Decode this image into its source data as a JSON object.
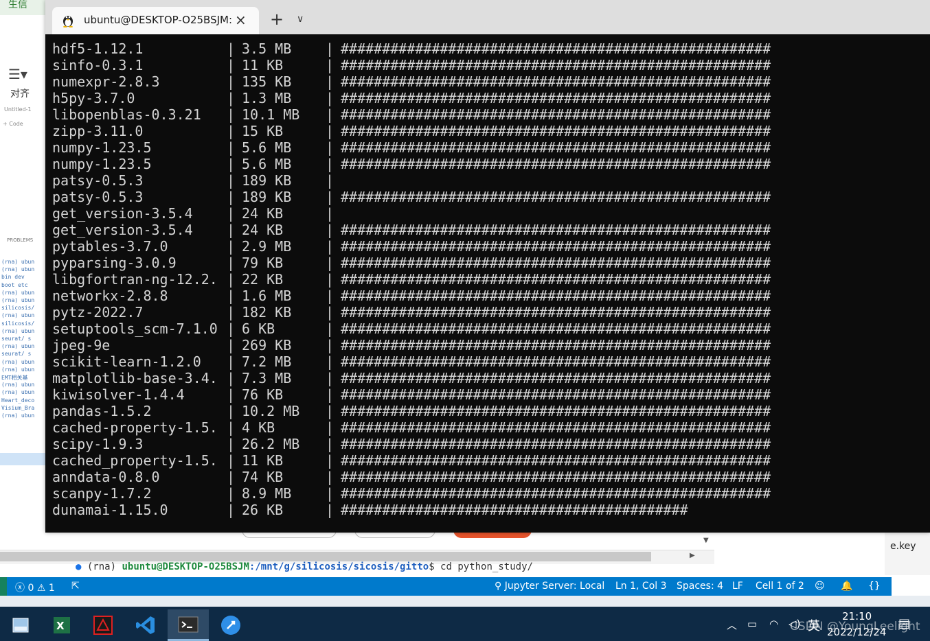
{
  "background_app": {
    "tab_label": "生信",
    "align_label": "对齐",
    "untitled_label": "Untitled-1",
    "code_button": "+ Code",
    "problems_label": "PROBLEMS",
    "side_lines": [
      "(rna) ubun",
      "(rna) ubun",
      "bin   dev",
      "boot  etc",
      "(rna) ubun",
      "(rna) ubun",
      "silicosis/",
      "(rna) ubun",
      "silicosis/",
      "(rna) ubun",
      "seurat/  s",
      "(rna) ubun",
      "seurat/  s",
      "(rna) ubun",
      "(rna) ubun",
      "EMT相关基",
      "(rna) ubun",
      "(rna) ubun",
      "Heart_deco",
      "Visium_Bra",
      "(rna) ubun"
    ]
  },
  "terminal_window": {
    "tab_title": "ubuntu@DESKTOP-O25BSJM: ",
    "close_icon": "×",
    "new_tab_icon": "+",
    "dropdown_icon": "⌄",
    "rows": [
      {
        "pkg": "hdf5-1.12.1",
        "size": "3.5 MB",
        "hashes": "####################################################"
      },
      {
        "pkg": "sinfo-0.3.1",
        "size": "11 KB",
        "hashes": "####################################################"
      },
      {
        "pkg": "numexpr-2.8.3",
        "size": "135 KB",
        "hashes": "####################################################"
      },
      {
        "pkg": "h5py-3.7.0",
        "size": "1.3 MB",
        "hashes": "####################################################"
      },
      {
        "pkg": "libopenblas-0.3.21",
        "size": "10.1 MB",
        "hashes": "####################################################"
      },
      {
        "pkg": "zipp-3.11.0",
        "size": "15 KB",
        "hashes": "####################################################"
      },
      {
        "pkg": "numpy-1.23.5",
        "size": "5.6 MB",
        "hashes": "####################################################"
      },
      {
        "pkg": "numpy-1.23.5",
        "size": "5.6 MB",
        "hashes": "####################################################"
      },
      {
        "pkg": "patsy-0.5.3",
        "size": "189 KB",
        "hashes": ""
      },
      {
        "pkg": "patsy-0.5.3",
        "size": "189 KB",
        "hashes": "####################################################"
      },
      {
        "pkg": "get_version-3.5.4",
        "size": "24 KB",
        "hashes": ""
      },
      {
        "pkg": "get_version-3.5.4",
        "size": "24 KB",
        "hashes": "####################################################"
      },
      {
        "pkg": "pytables-3.7.0",
        "size": "2.9 MB",
        "hashes": "####################################################"
      },
      {
        "pkg": "pyparsing-3.0.9",
        "size": "79 KB",
        "hashes": "####################################################"
      },
      {
        "pkg": "libgfortran-ng-12.2.",
        "size": "22 KB",
        "hashes": "####################################################"
      },
      {
        "pkg": "networkx-2.8.8",
        "size": "1.6 MB",
        "hashes": "####################################################"
      },
      {
        "pkg": "pytz-2022.7",
        "size": "182 KB",
        "hashes": "####################################################"
      },
      {
        "pkg": "setuptools_scm-7.1.0",
        "size": "6 KB",
        "hashes": "####################################################"
      },
      {
        "pkg": "jpeg-9e",
        "size": "269 KB",
        "hashes": "####################################################"
      },
      {
        "pkg": "scikit-learn-1.2.0",
        "size": "7.2 MB",
        "hashes": "####################################################"
      },
      {
        "pkg": "matplotlib-base-3.4.",
        "size": "7.3 MB",
        "hashes": "####################################################"
      },
      {
        "pkg": "kiwisolver-1.4.4",
        "size": "76 KB",
        "hashes": "####################################################"
      },
      {
        "pkg": "pandas-1.5.2",
        "size": "10.2 MB",
        "hashes": "####################################################"
      },
      {
        "pkg": "cached-property-1.5.",
        "size": "4 KB",
        "hashes": "####################################################"
      },
      {
        "pkg": "scipy-1.9.3",
        "size": "26.2 MB",
        "hashes": "####################################################"
      },
      {
        "pkg": "cached_property-1.5.",
        "size": "11 KB",
        "hashes": "####################################################"
      },
      {
        "pkg": "anndata-0.8.0",
        "size": "74 KB",
        "hashes": "####################################################"
      },
      {
        "pkg": "scanpy-1.7.2",
        "size": "8.9 MB",
        "hashes": "####################################################"
      },
      {
        "pkg": "dunamai-1.15.0",
        "size": "26 KB",
        "hashes": "##########################################"
      }
    ],
    "separator": "|"
  },
  "vscode_terminal": {
    "prompt_env": "(rna)",
    "prompt_user": "ubuntu@DESKTOP-O25BSJM",
    "prompt_path": ":/mnt/g/silicosis/sicosis/gitto",
    "command": "$ cd python_study/"
  },
  "statusbar": {
    "errors": "0",
    "warnings": "1",
    "jupyter": "Jupyter Server: Local",
    "position": "Ln 1, Col 3",
    "spaces": "Spaces: 4",
    "eol": "LF",
    "cell": "Cell 1 of 2"
  },
  "right_remnant": {
    "label": "e.key"
  },
  "taskbar": {
    "apps": [
      "file-manager-icon",
      "excel-icon",
      "acrobat-icon",
      "vscode-icon",
      "terminal-icon",
      "rocket-icon"
    ],
    "ime": "英",
    "time": "21:10",
    "date": "2022/12/24",
    "watermark": "CSDN @YoungLeelight"
  },
  "colors": {
    "terminal_bg": "#0c0c0c",
    "statusbar_bg": "#007acc",
    "taskbar_bg": "#0e2a45",
    "prompt_user": "#1f8a3e",
    "prompt_path": "#1f5fbf"
  }
}
